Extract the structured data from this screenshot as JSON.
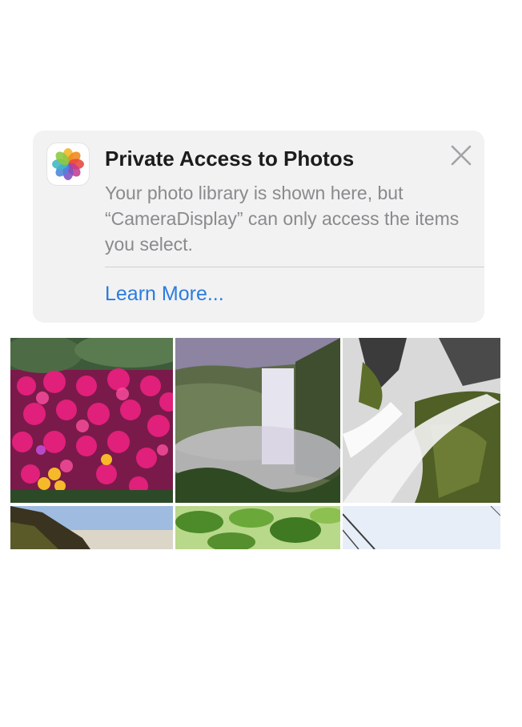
{
  "banner": {
    "title": "Private Access to Photos",
    "message": "Your photo library is shown here, but “CameraDisplay” can only access the items you select.",
    "link": "Learn More...",
    "icon": "photos-app-icon",
    "close_icon": "close-icon"
  },
  "colors": {
    "banner_bg": "#f2f2f2",
    "link": "#2a7ce0",
    "title": "#1c1c1e",
    "body_text": "#8a8a8e"
  },
  "photos": [
    {
      "subject": "pink flowers"
    },
    {
      "subject": "waterfall valley"
    },
    {
      "subject": "waterfall rocks"
    },
    {
      "subject": "hillside sky"
    },
    {
      "subject": "green leaves"
    },
    {
      "subject": "sky with branches"
    }
  ]
}
